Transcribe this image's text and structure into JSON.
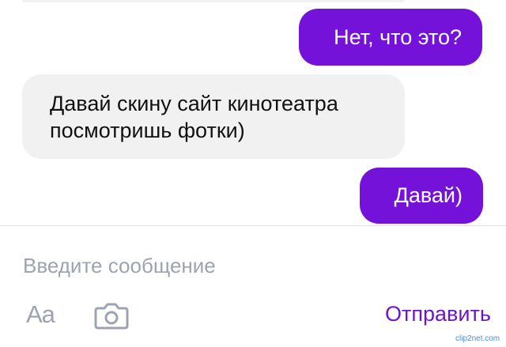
{
  "conversation": {
    "messages": [
      {
        "direction": "outgoing",
        "text": "Нет, что это?"
      },
      {
        "direction": "incoming",
        "text": "Давай скину сайт кинотеатра\nпосмотришь фотки)"
      },
      {
        "direction": "outgoing",
        "text": "Давай)"
      }
    ]
  },
  "composer": {
    "placeholder": "Введите сообщение",
    "format_label": "Aa",
    "camera_icon": "camera-icon",
    "send_label": "Отправить"
  },
  "watermark": {
    "text": "clip2net.com"
  },
  "colors": {
    "outgoing_bubble": "#7412d9",
    "incoming_bubble": "#f1f1f1",
    "send_text": "#6d16c9",
    "placeholder_text": "#9da3b1"
  }
}
